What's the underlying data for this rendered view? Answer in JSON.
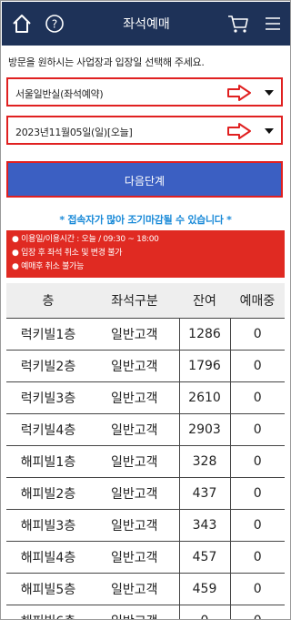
{
  "header": {
    "title": "좌석예매",
    "icons": [
      "home-icon",
      "help-icon",
      "cart-icon",
      "menu-icon"
    ],
    "background": "#1e3258"
  },
  "notice": "방문을 원하시는 사업장과 입장일 선택해 주세요.",
  "venue_select": {
    "value": "서울일반실(좌석예약)"
  },
  "date_select": {
    "value": "2023년11월05일(일)[오늘]"
  },
  "next_button": {
    "label": "다음단계",
    "color": "#3b5fc2"
  },
  "warning": "* 접속자가 많아 조기마감될 수 있습니다 *",
  "info": {
    "lines": [
      "● 이용일/이용시간 : 오늘 / 09:30 ~ 18:00",
      "● 입장 후 좌석 취소 및 변경 불가",
      "● 예매후 취소 불가능"
    ],
    "color": "#e02a22"
  },
  "table": {
    "headers": [
      "층",
      "좌석구분",
      "잔여",
      "예매중"
    ],
    "rows": [
      [
        "럭키빌1층",
        "일반고객",
        "1286",
        "0"
      ],
      [
        "럭키빌2층",
        "일반고객",
        "1796",
        "0"
      ],
      [
        "럭키빌3층",
        "일반고객",
        "2610",
        "0"
      ],
      [
        "럭키빌4층",
        "일반고객",
        "2903",
        "0"
      ],
      [
        "해피빌1층",
        "일반고객",
        "328",
        "0"
      ],
      [
        "해피빌2층",
        "일반고객",
        "437",
        "0"
      ],
      [
        "해피빌3층",
        "일반고객",
        "343",
        "0"
      ],
      [
        "해피빌4층",
        "일반고객",
        "457",
        "0"
      ],
      [
        "해피빌5층",
        "일반고객",
        "459",
        "0"
      ],
      [
        "해피빌6층",
        "일반고객",
        "0",
        "0"
      ]
    ]
  }
}
